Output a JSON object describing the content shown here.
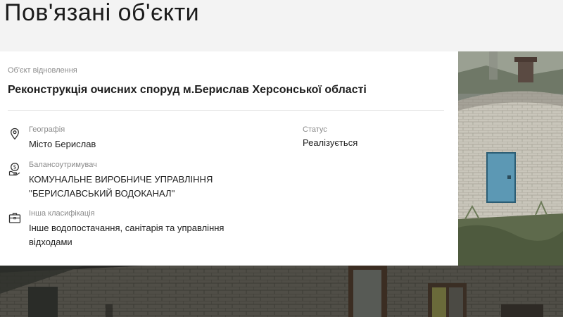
{
  "section": {
    "title": "Пов'язані об'єкти"
  },
  "card": {
    "type_label": "Об'єкт відновлення",
    "title": "Реконструкція очисних споруд м.Берислав Херсонської області",
    "geography": {
      "label": "Географія",
      "value": "Місто Берислав",
      "icon": "location-pin-icon"
    },
    "status": {
      "label": "Статус",
      "value": "Реалізується"
    },
    "balance_holder": {
      "label": "Балансоутримувач",
      "value_line1": "КОМУНАЛЬНЕ ВИРОБНИЧЕ УПРАВЛІННЯ",
      "value_line2": "''БЕРИСЛАВСЬКИЙ ВОДОКАНАЛ''",
      "icon": "money-hand-icon"
    },
    "classification": {
      "label": "Інша класифікація",
      "value_line1": "Інше водопостачання, санітарія та управління",
      "value_line2": "відходами",
      "icon": "briefcase-icon"
    }
  },
  "colors": {
    "background": "#f3f3f3",
    "card": "#ffffff",
    "muted": "#8a8a8a",
    "text": "#1e1e1e"
  }
}
